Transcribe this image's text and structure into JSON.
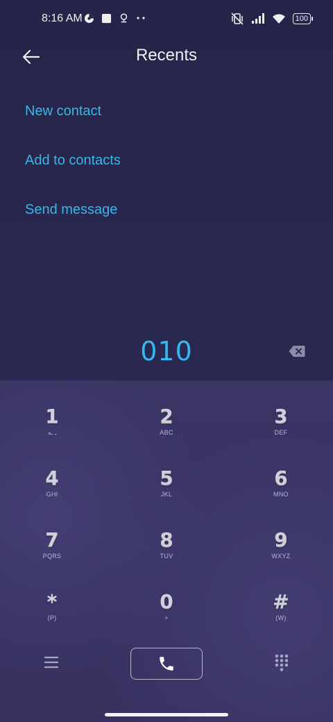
{
  "status_bar": {
    "time": "8:16 AM",
    "battery": "100"
  },
  "app_bar": {
    "title": "Recents"
  },
  "menu": [
    {
      "label": "New contact"
    },
    {
      "label": "Add to contacts"
    },
    {
      "label": "Send message"
    }
  ],
  "dial": {
    "number": "010"
  },
  "keypad": [
    {
      "digit": "1",
      "letters": "ـ ـه"
    },
    {
      "digit": "2",
      "letters": "ABC"
    },
    {
      "digit": "3",
      "letters": "DEF"
    },
    {
      "digit": "4",
      "letters": "GHI"
    },
    {
      "digit": "5",
      "letters": "JKL"
    },
    {
      "digit": "6",
      "letters": "MNO"
    },
    {
      "digit": "7",
      "letters": "PQRS"
    },
    {
      "digit": "8",
      "letters": "TUV"
    },
    {
      "digit": "9",
      "letters": "WXYZ"
    },
    {
      "digit": "*",
      "letters": "(P)"
    },
    {
      "digit": "0",
      "letters": "+"
    },
    {
      "digit": "#",
      "letters": "(W)"
    }
  ],
  "colors": {
    "accent": "#39b6e6",
    "background": "#272548",
    "keypad_bg": "#383363"
  }
}
